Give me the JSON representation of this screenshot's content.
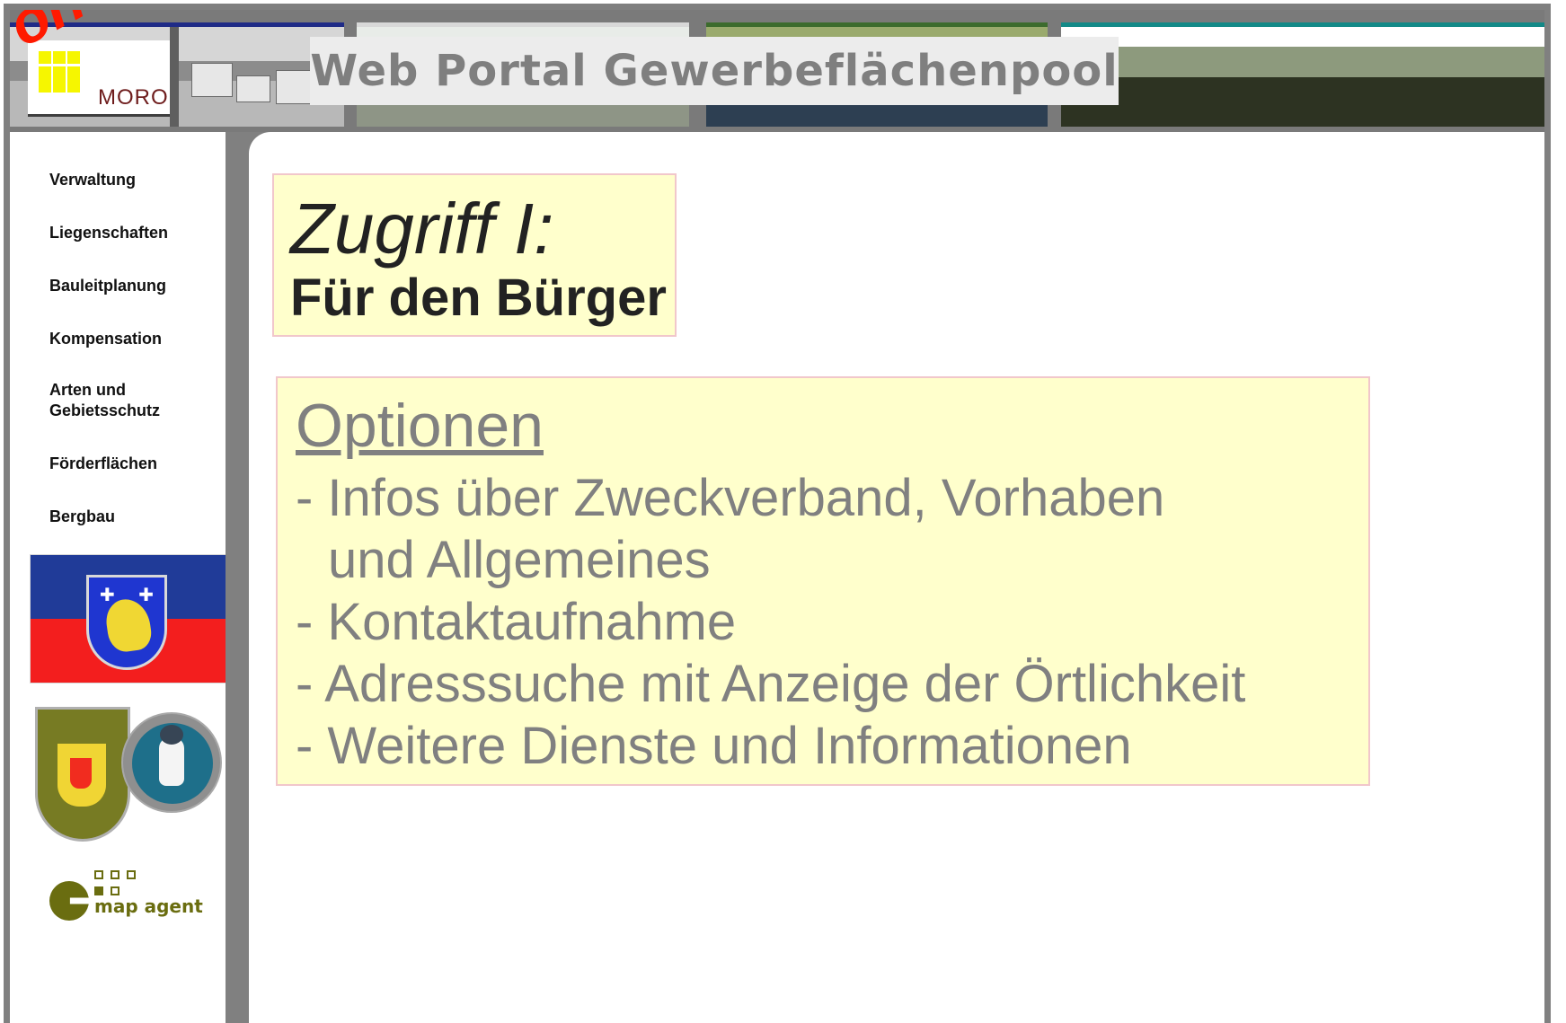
{
  "header": {
    "logo_text": "MORO",
    "overlay_text": "onta",
    "title": "Web Portal Gewerbeflächenpool"
  },
  "sidebar": {
    "items": [
      "Verwaltung",
      "Liegenschaften",
      "Bauleitplanung",
      "Kompensation",
      "Arten und Gebietsschutz",
      "Förderflächen",
      "Bergbau"
    ]
  },
  "brand": {
    "mapagent": "map agent"
  },
  "content": {
    "access": {
      "title": "Zugriff I:",
      "subtitle": "Für den Bürger"
    },
    "options": {
      "heading": "Optionen",
      "items": [
        "- Infos über Zweckverband, Vorhaben",
        "und Allgemeines",
        "- Kontaktaufnahme",
        "- Adresssuche mit Anzeige der Örtlichkeit",
        "- Weitere Dienste und Informationen"
      ]
    }
  },
  "colors": {
    "title_gray": "#7f7f7f",
    "content_yellow": "#ffffcc",
    "border_pink": "#f1c7cb",
    "overlay_red": "#ff1a00",
    "flag_blue": "#203b98",
    "flag_red": "#f31e1e",
    "mapagent_olive": "#6a6d10"
  },
  "icons": {
    "moro_logo": "moro-logo-icon",
    "header_photo_1": "town-photo-icon",
    "header_photo_2": "landscape-photo-icon",
    "header_photo_3": "industrial-photo-icon",
    "header_photo_4": "tree-photo-icon",
    "flag": "coat-of-arms-flag-icon",
    "crest": "crest-and-mascot-icon",
    "mapagent": "mapagent-logo-icon"
  }
}
